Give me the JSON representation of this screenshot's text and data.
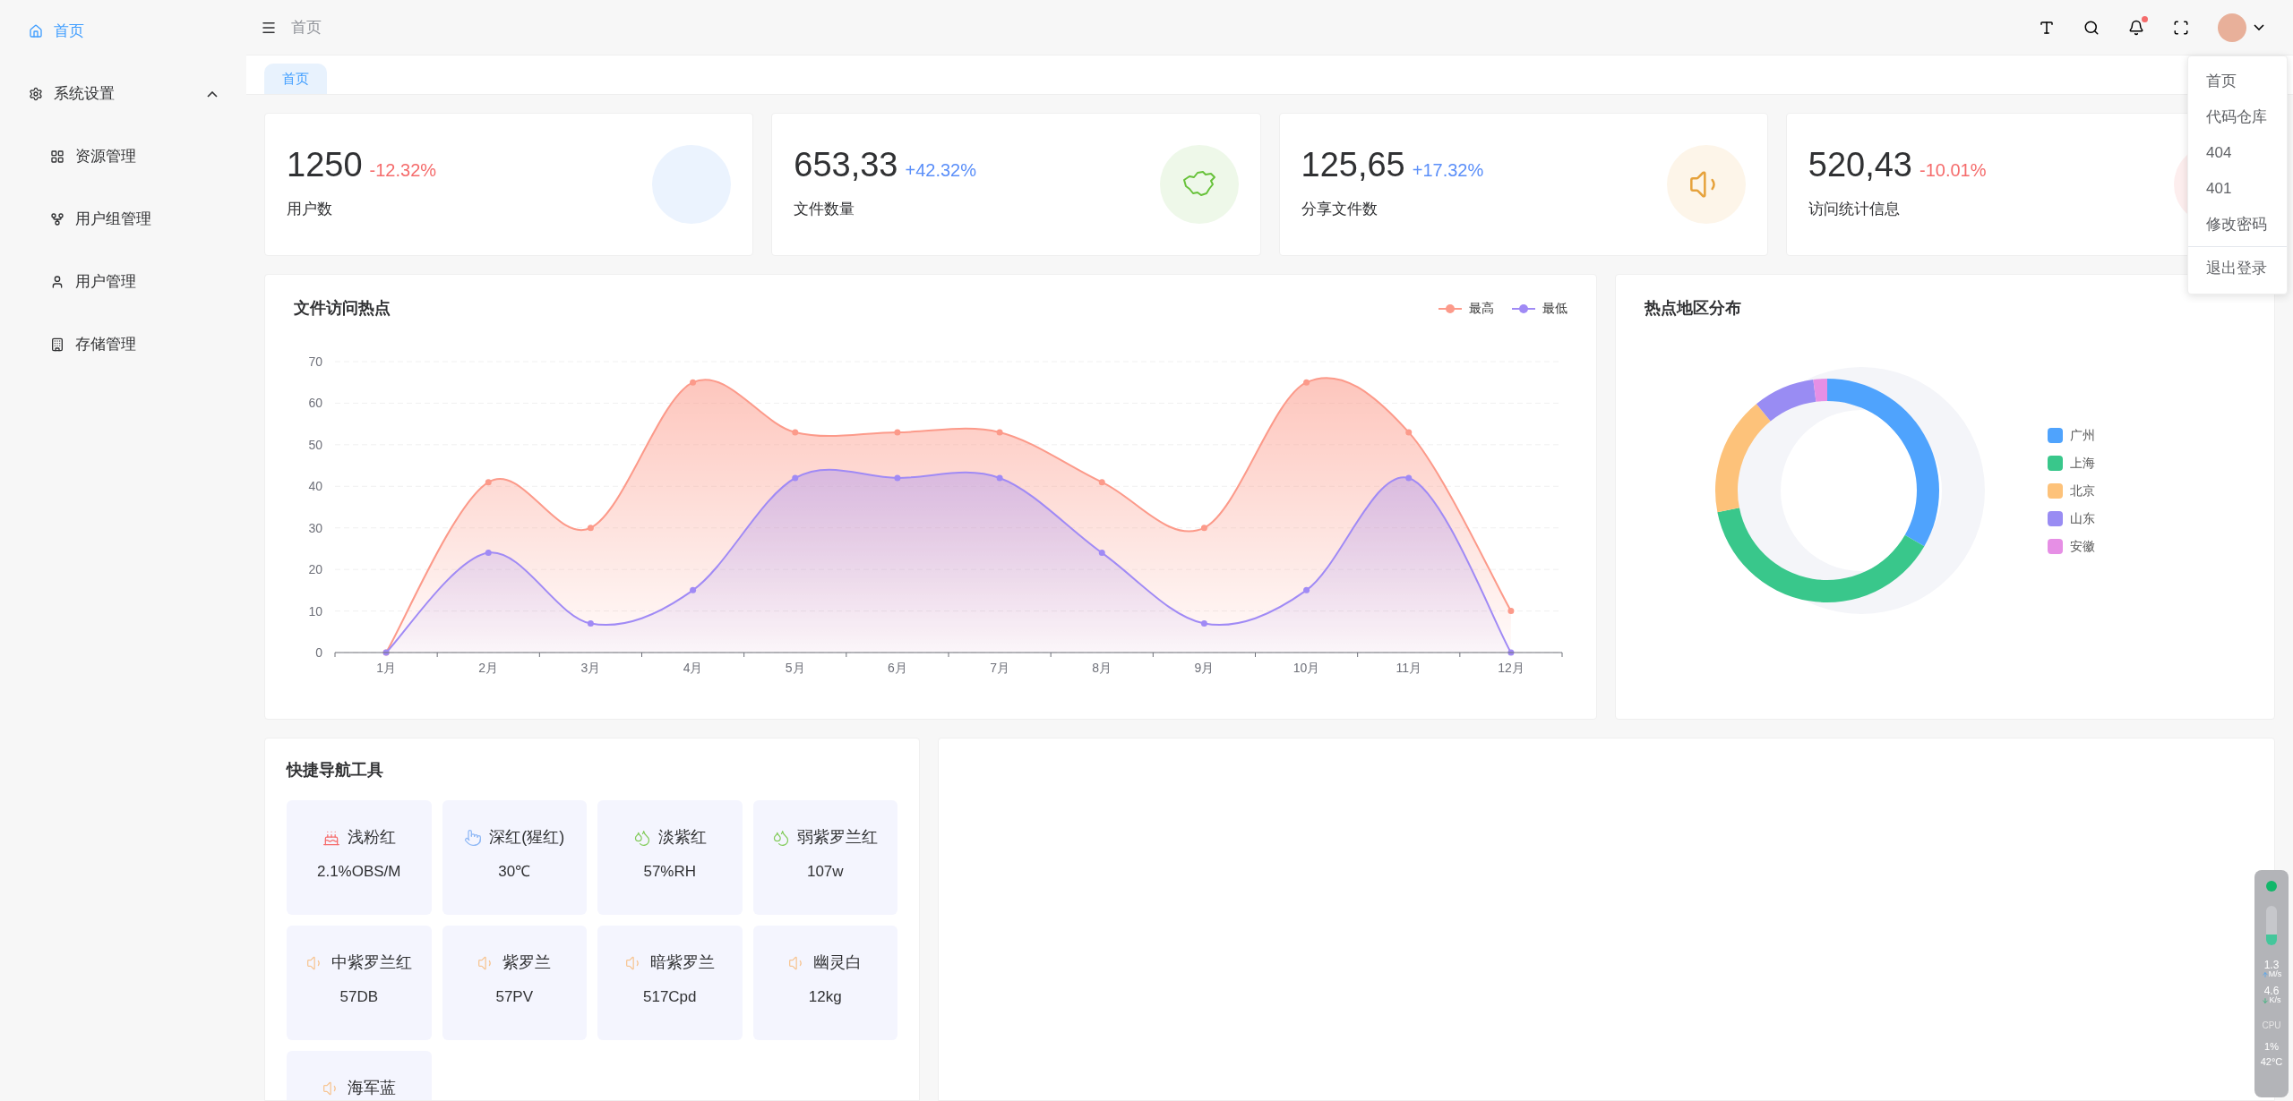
{
  "sidebar": {
    "items": [
      {
        "label": "首页",
        "selected": true
      },
      {
        "label": "系统设置",
        "selected": false,
        "expanded": true,
        "children": [
          {
            "label": "资源管理",
            "selected": false
          },
          {
            "label": "用户组管理",
            "selected": false
          },
          {
            "label": "用户管理",
            "selected": false
          },
          {
            "label": "存储管理",
            "selected": false
          }
        ]
      }
    ]
  },
  "header": {
    "breadcrumb": "首页",
    "notifications": {
      "unread": true
    }
  },
  "tabs": [
    {
      "label": "首页",
      "selected": true
    }
  ],
  "user_menu": {
    "items": [
      {
        "label": "首页",
        "divider_before": false
      },
      {
        "label": "代码仓库",
        "divider_before": false
      },
      {
        "label": "404",
        "divider_before": false
      },
      {
        "label": "401",
        "divider_before": false
      },
      {
        "label": "修改密码",
        "divider_before": false
      },
      {
        "label": "退出登录",
        "divider_before": true
      }
    ]
  },
  "stats": [
    {
      "value": "1250",
      "change": "-12.32%",
      "kind": "down",
      "label": "用户数"
    },
    {
      "value": "653,33",
      "change": "+42.32%",
      "kind": "up",
      "label": "文件数量"
    },
    {
      "value": "125,65",
      "change": "+17.32%",
      "kind": "up",
      "label": "分享文件数"
    },
    {
      "value": "520,43",
      "change": "-10.01%",
      "kind": "down",
      "label": "访问统计信息"
    }
  ],
  "visits": {
    "title": "文件访问热点",
    "chart_data": {
      "type": "area",
      "categories": [
        "1月",
        "2月",
        "3月",
        "4月",
        "5月",
        "6月",
        "7月",
        "8月",
        "9月",
        "10月",
        "11月",
        "12月"
      ],
      "series": [
        {
          "name": "最高",
          "color": "#fc9a8a",
          "values": [
            0,
            41,
            30,
            65,
            53,
            53,
            53,
            41,
            30,
            65,
            53,
            10
          ]
        },
        {
          "name": "最低",
          "color": "#a08af5",
          "values": [
            0,
            24,
            7,
            15,
            42,
            42,
            42,
            24,
            7,
            15,
            42,
            0
          ]
        }
      ],
      "ylim": [
        0,
        70
      ],
      "grid": true,
      "stacked": false,
      "yticks": [
        0,
        10,
        20,
        30,
        40,
        50,
        60,
        70
      ]
    }
  },
  "regions": {
    "title": "热点地区分布",
    "legend": [
      {
        "label": "广州",
        "color": "#4fa3fd"
      },
      {
        "label": "上海",
        "color": "#39c78b"
      },
      {
        "label": "北京",
        "color": "#fdc27a"
      },
      {
        "label": "山东",
        "color": "#998cf3"
      },
      {
        "label": "安徽",
        "color": "#e68fe5"
      }
    ]
  },
  "quick_nav": {
    "title": "快捷导航工具",
    "tiles": [
      {
        "label": "浅粉红",
        "value": "2.1%OBS/M"
      },
      {
        "label": "深红(猩红)",
        "value": "30℃"
      },
      {
        "label": "淡紫红",
        "value": "57%RH"
      },
      {
        "label": "弱紫罗兰红",
        "value": "107w"
      },
      {
        "label": "中紫罗兰红",
        "value": "57DB"
      },
      {
        "label": "紫罗兰",
        "value": "57PV"
      },
      {
        "label": "暗紫罗兰",
        "value": "517Cpd"
      },
      {
        "label": "幽灵白",
        "value": "12kg"
      },
      {
        "label": "海军蓝"
      }
    ]
  },
  "system_monitor": {
    "upload": "1.3",
    "upload_unit": "M/s",
    "download": "4.6",
    "download_unit": "K/s",
    "cpu_label": "CPU",
    "cpu": "1%",
    "temperature": "42°C"
  }
}
